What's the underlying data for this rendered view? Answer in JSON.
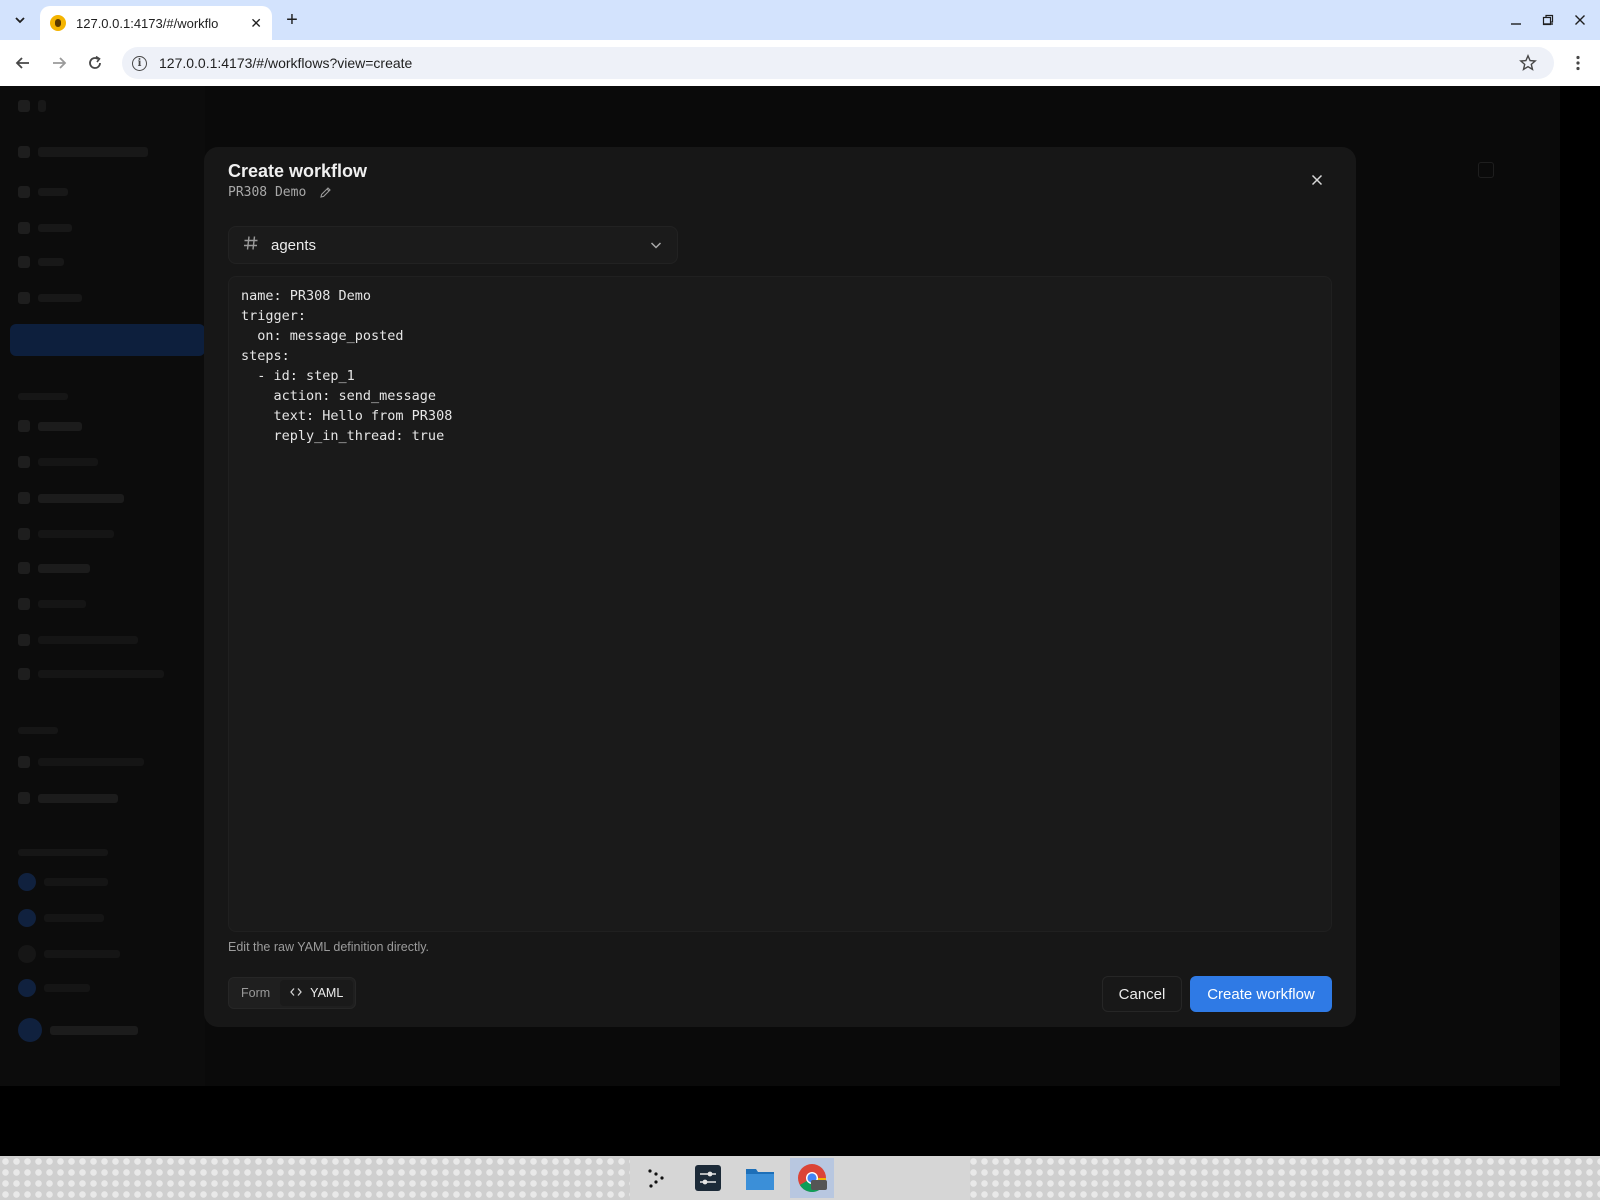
{
  "browser": {
    "tab_title": "127.0.0.1:4173/#/workflo",
    "url": "127.0.0.1:4173/#/workflows?view=create"
  },
  "modal": {
    "title": "Create workflow",
    "workflow_name": "PR308 Demo",
    "channel": {
      "icon": "hash-icon",
      "value": "agents"
    },
    "yaml": "name: PR308 Demo\ntrigger:\n  on: message_posted\nsteps:\n  - id: step_1\n    action: send_message\n    text: Hello from PR308\n    reply_in_thread: true",
    "help_text": "Edit the raw YAML definition directly.",
    "mode_toggle": {
      "form_label": "Form",
      "yaml_label": "YAML",
      "active": "YAML"
    },
    "cancel_label": "Cancel",
    "submit_label": "Create workflow"
  },
  "colors": {
    "accent": "#2f7ae5",
    "modal_bg": "#171717",
    "backdrop": "#0a0a0a"
  }
}
